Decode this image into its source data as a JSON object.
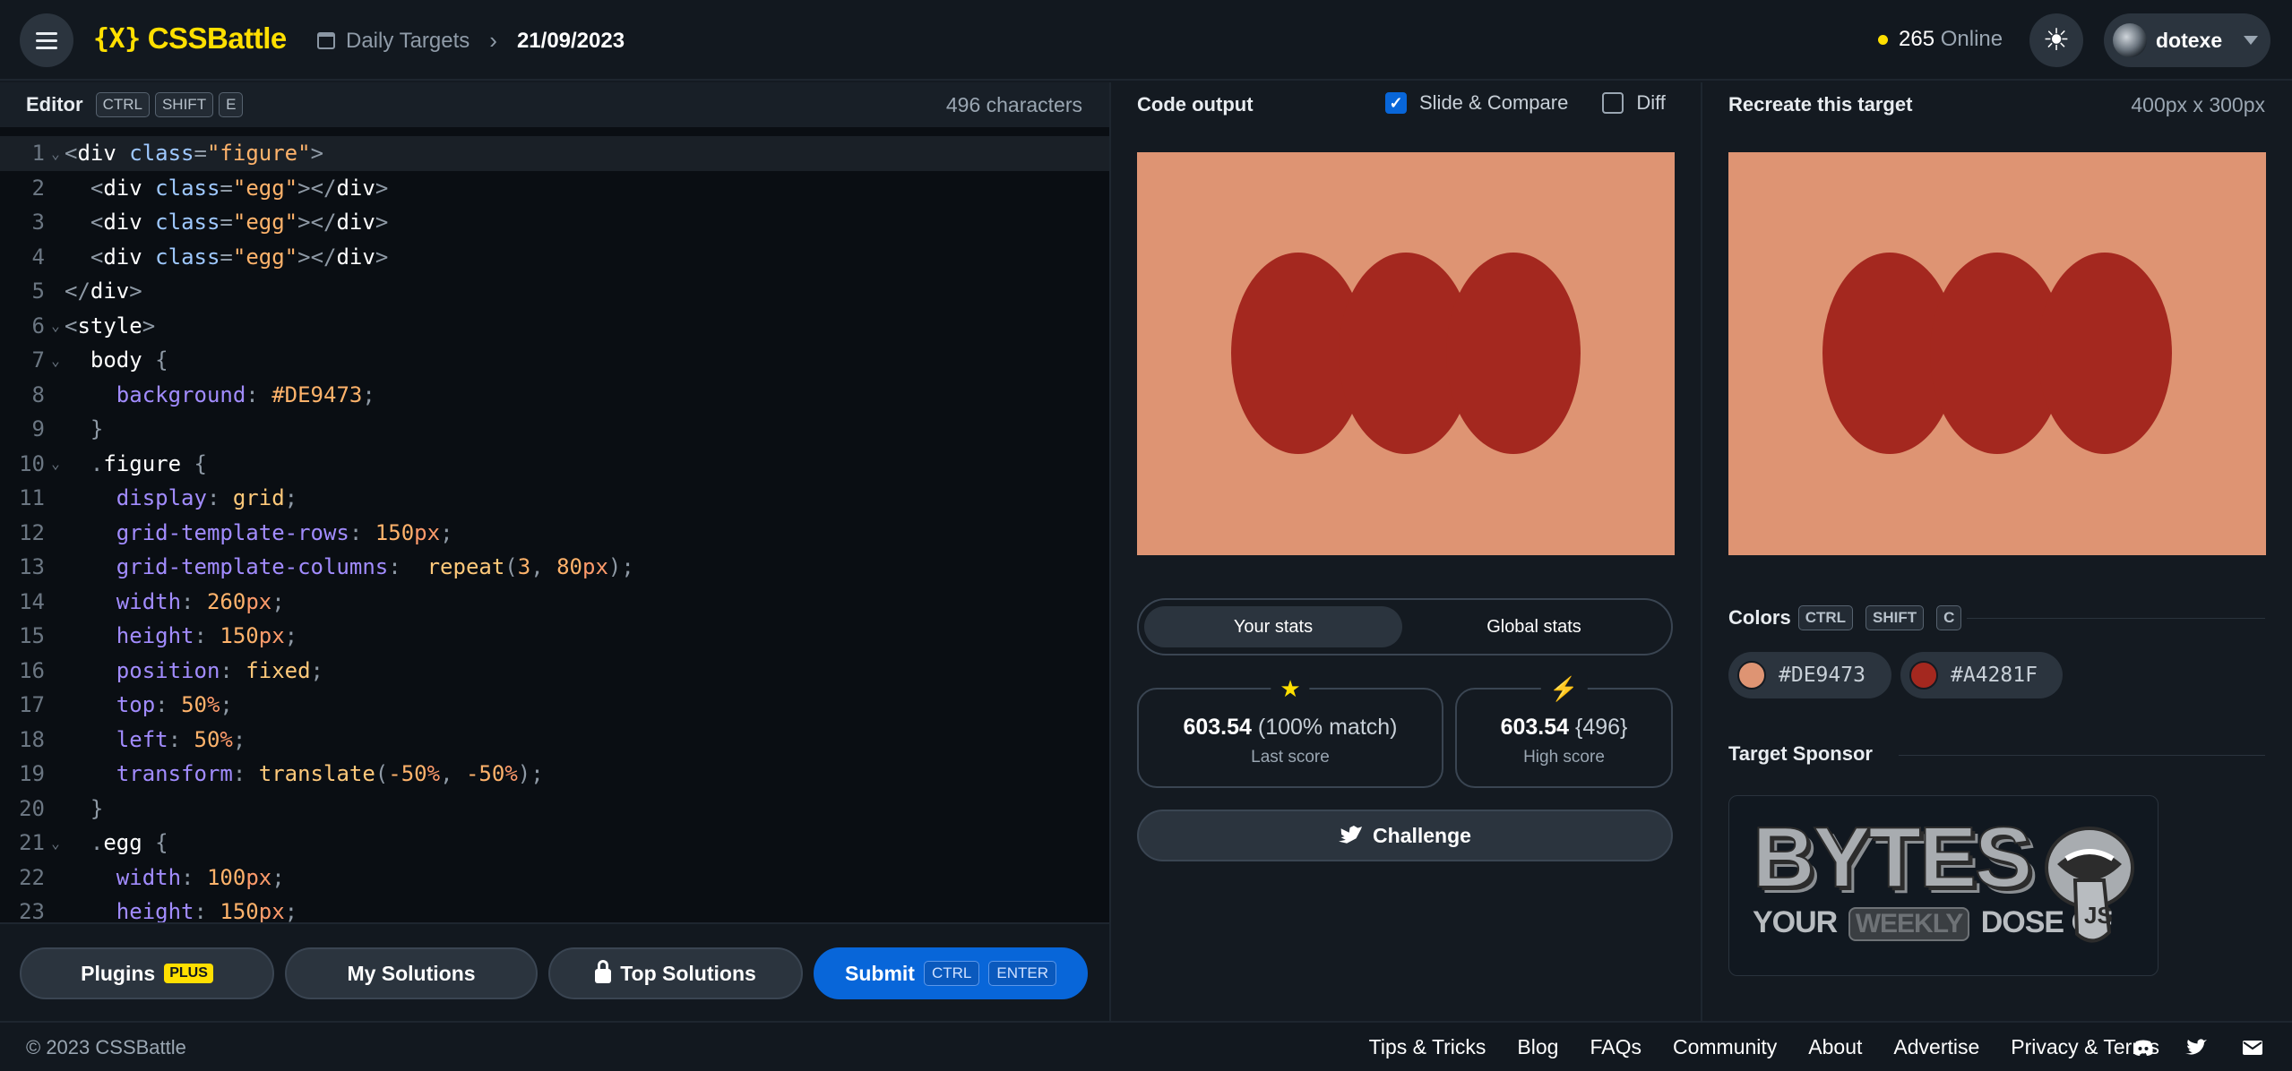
{
  "header": {
    "logo_text": "CSSBattle",
    "logo_mark": "{X}",
    "breadcrumb_section": "Daily Targets",
    "breadcrumb_date": "21/09/2023",
    "online_count": "265",
    "online_label": "Online",
    "username": "dotexe"
  },
  "editor": {
    "title": "Editor",
    "shortcut": [
      "CTRL",
      "SHIFT",
      "E"
    ],
    "char_count": "496 characters"
  },
  "code_lines": [
    {
      "n": "1",
      "fold": true
    },
    {
      "n": "2"
    },
    {
      "n": "3"
    },
    {
      "n": "4"
    },
    {
      "n": "5"
    },
    {
      "n": "6",
      "fold": true
    },
    {
      "n": "7",
      "fold": true
    },
    {
      "n": "8"
    },
    {
      "n": "9"
    },
    {
      "n": "10",
      "fold": true
    },
    {
      "n": "11"
    },
    {
      "n": "12"
    },
    {
      "n": "13"
    },
    {
      "n": "14"
    },
    {
      "n": "15"
    },
    {
      "n": "16"
    },
    {
      "n": "17"
    },
    {
      "n": "18"
    },
    {
      "n": "19"
    },
    {
      "n": "20"
    },
    {
      "n": "21",
      "fold": true
    },
    {
      "n": "22"
    },
    {
      "n": "23"
    }
  ],
  "code": {
    "l1": [
      "<",
      "div",
      " class",
      "=",
      "\"figure\"",
      ">"
    ],
    "l2": [
      "<",
      "div",
      " class",
      "=",
      "\"egg\"",
      "></",
      "div",
      ">"
    ],
    "l3": [
      "<",
      "div",
      " class",
      "=",
      "\"egg\"",
      "></",
      "div",
      ">"
    ],
    "l4": [
      "<",
      "div",
      " class",
      "=",
      "\"egg\"",
      "></",
      "div",
      ">"
    ],
    "l5": [
      "</",
      "div",
      ">"
    ],
    "l6": [
      "<",
      "style",
      ">"
    ],
    "l7": [
      "body",
      " {"
    ],
    "l8": [
      "background",
      ": ",
      "#DE9473",
      ";"
    ],
    "l9": [
      "}"
    ],
    "l10": [
      ".",
      "figure",
      " {"
    ],
    "l11": [
      "display",
      ": ",
      "grid",
      ";"
    ],
    "l12": [
      "grid-template-rows",
      ": ",
      "150",
      "px",
      ";"
    ],
    "l13": [
      "grid-template-columns",
      ":  ",
      "repeat",
      "(",
      "3",
      ", ",
      "80",
      "px",
      ");"
    ],
    "l14": [
      "width",
      ": ",
      "260",
      "px",
      ";"
    ],
    "l15": [
      "height",
      ": ",
      "150",
      "px",
      ";"
    ],
    "l16": [
      "position",
      ": ",
      "fixed",
      ";"
    ],
    "l17": [
      "top",
      ": ",
      "50",
      "%",
      ";"
    ],
    "l18": [
      "left",
      ": ",
      "50",
      "%",
      ";"
    ],
    "l19": [
      "transform",
      ": ",
      "translate",
      "(",
      "-50",
      "%",
      ", ",
      "-50",
      "%",
      ");"
    ],
    "l20": [
      "}"
    ],
    "l21": [
      ".",
      "egg",
      " {"
    ],
    "l22": [
      "width",
      ": ",
      "100",
      "px",
      ";"
    ],
    "l23": [
      "height",
      ": ",
      "150",
      "px",
      ";"
    ]
  },
  "editor_footer": {
    "plugins_label": "Plugins",
    "plugins_tag": "PLUS",
    "my_solutions_label": "My Solutions",
    "top_solutions_label": "Top Solutions",
    "submit_label": "Submit",
    "submit_keys": [
      "CTRL",
      "ENTER"
    ]
  },
  "output": {
    "title": "Code output",
    "slide_compare_label": "Slide & Compare",
    "slide_compare_checked": true,
    "diff_label": "Diff",
    "diff_checked": false,
    "background_color": "#DE9473",
    "shape_color": "#A4281F"
  },
  "stats": {
    "tab_active": "Your stats",
    "tab_inactive": "Global stats",
    "last_score_value": "603.54",
    "last_score_extra": "(100% match)",
    "last_score_label": "Last score",
    "high_score_value": "603.54",
    "high_score_extra": "{496}",
    "high_score_label": "High score",
    "challenge_label": "Challenge"
  },
  "target": {
    "title": "Recreate this target",
    "size": "400px x 300px",
    "colors_title": "Colors",
    "colors_shortcut": [
      "CTRL",
      "SHIFT",
      "C"
    ],
    "colors": [
      {
        "hex": "#DE9473",
        "label": "#DE9473"
      },
      {
        "hex": "#A4281F",
        "label": "#A4281F"
      }
    ],
    "sponsor_title": "Target Sponsor",
    "sponsor_name": "BYTES",
    "sponsor_tagline_a": "YOUR",
    "sponsor_tagline_b": "WEEKLY",
    "sponsor_tagline_c": "DOSE OF",
    "sponsor_badge": "JS"
  },
  "footer": {
    "copyright": "© 2023 CSSBattle",
    "links": [
      "Tips & Tricks",
      "Blog",
      "FAQs",
      "Community",
      "About",
      "Advertise",
      "Privacy & Terms"
    ],
    "icons": [
      "discord-icon",
      "twitter-icon",
      "mail-icon"
    ]
  }
}
